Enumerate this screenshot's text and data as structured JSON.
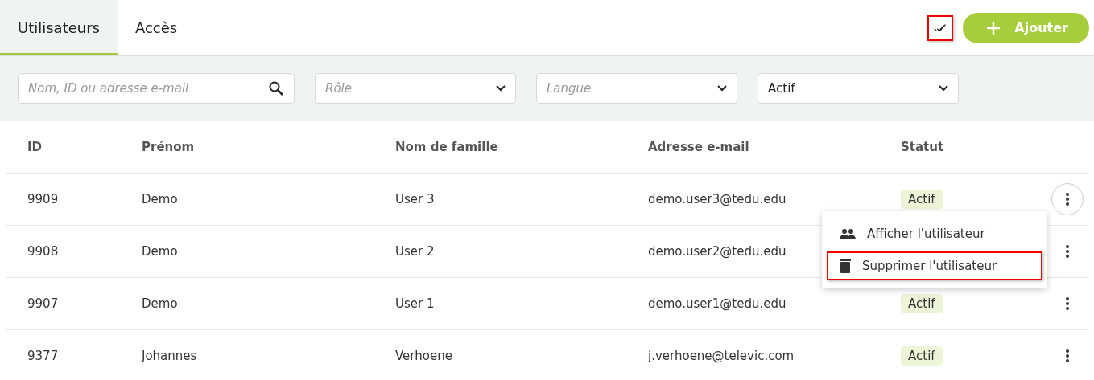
{
  "tabs": [
    {
      "label": "Utilisateurs",
      "selected": true
    },
    {
      "label": "Accès",
      "selected": false
    }
  ],
  "toolbar": {
    "select_all_highlighted": true,
    "add_button": "Ajouter"
  },
  "filters": {
    "search": {
      "placeholder": "Nom, ID ou adresse e-mail"
    },
    "dropdowns": [
      {
        "placeholder": "Rôle"
      },
      {
        "placeholder": "Langue"
      },
      {
        "value": "Actif"
      }
    ]
  },
  "table": {
    "columns": [
      "ID",
      "Prénom",
      "Nom de famille",
      "Adresse e-mail",
      "Statut"
    ],
    "rows": [
      {
        "cells": [
          "9909",
          "Demo",
          "User 3",
          "demo.user3@tedu.edu"
        ],
        "status": "Actif",
        "menu_open": true
      },
      {
        "cells": [
          "9908",
          "Demo",
          "User 2",
          "demo.user2@tedu.edu"
        ],
        "menu_open": false
      },
      {
        "cells": [
          "9907",
          "Demo",
          "User 1",
          "demo.user1@tedu.edu"
        ],
        "status": "Actif",
        "menu_open": false
      },
      {
        "cells": [
          "9377",
          "Johannes",
          "Verhoene",
          "j.verhoene@televic.com"
        ],
        "status": "Actif",
        "menu_open": false
      }
    ]
  },
  "row_menu": {
    "items": [
      {
        "kind": "view",
        "label": "Afficher l'utilisateur",
        "highlighted": false
      },
      {
        "kind": "delete",
        "label": "Supprimer l'utilisateur",
        "highlighted": true
      }
    ]
  }
}
